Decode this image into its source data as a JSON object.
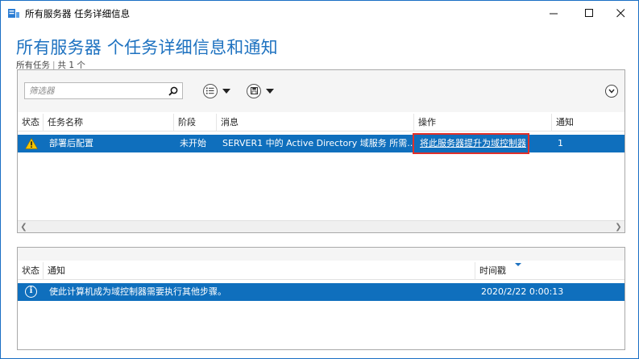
{
  "window": {
    "title": "所有服务器 任务详细信息"
  },
  "header": {
    "page_title": "所有服务器 个任务详细信息和通知",
    "subtitle_scope": "所有任务",
    "subtitle_sep": "|",
    "subtitle_count": "共 1 个"
  },
  "toolbar": {
    "filter_placeholder": "筛选器"
  },
  "tasks": {
    "columns": [
      "状态",
      "任务名称",
      "阶段",
      "消息",
      "操作",
      "通知"
    ],
    "rows": [
      {
        "status_icon": "warning-icon",
        "name": "部署后配置",
        "stage": "未开始",
        "message": "SERVER1 中的 Active Directory 域服务 所需...",
        "action": "将此服务器提升为域控制器",
        "notifications": "1"
      }
    ]
  },
  "notifications": {
    "columns": [
      "状态",
      "通知",
      "时间戳"
    ],
    "rows": [
      {
        "status_icon": "info-icon",
        "text": "使此计算机成为域控制器需要执行其他步骤。",
        "timestamp": "2020/2/22 0:00:13"
      }
    ]
  },
  "colors": {
    "accent": "#1e72c0",
    "selection": "#0f6fbd",
    "highlight": "#e0302a",
    "warning": "#f5c400"
  }
}
